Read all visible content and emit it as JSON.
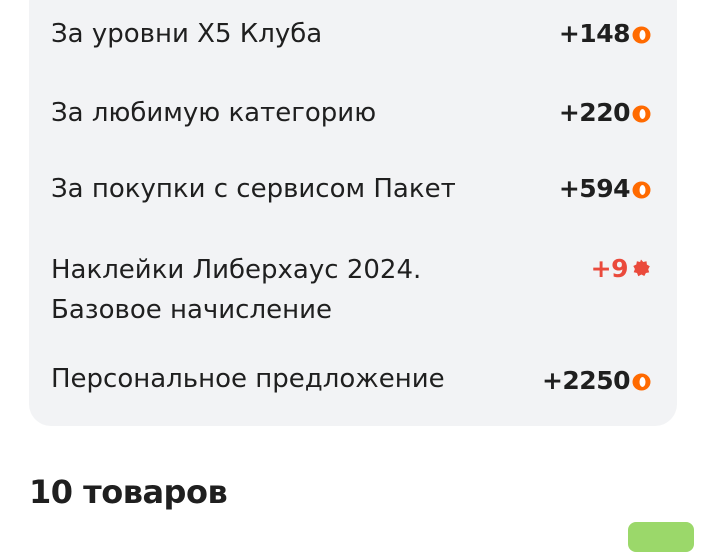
{
  "bonus_rows": [
    {
      "label": "За уровни X5 Клуба",
      "value": "+148",
      "icon": "coin-icon"
    },
    {
      "label": "За любимую категорию",
      "value": "+220",
      "icon": "coin-icon"
    },
    {
      "label": "За покупки с сервисом Пакет",
      "value": "+594",
      "icon": "coin-icon"
    },
    {
      "label": "Наклейки Либерхаус 2024. Базовое начисление",
      "value": "+9",
      "icon": "sticker-icon"
    },
    {
      "label": "Персональное предложение",
      "value": "+2250",
      "icon": "coin-icon"
    }
  ],
  "products_heading": "10 товаров",
  "colors": {
    "coin": "#ff6a00",
    "sticker": "#ea4a3c",
    "card_background": "#f2f3f5",
    "green_button": "#9bd86a"
  }
}
